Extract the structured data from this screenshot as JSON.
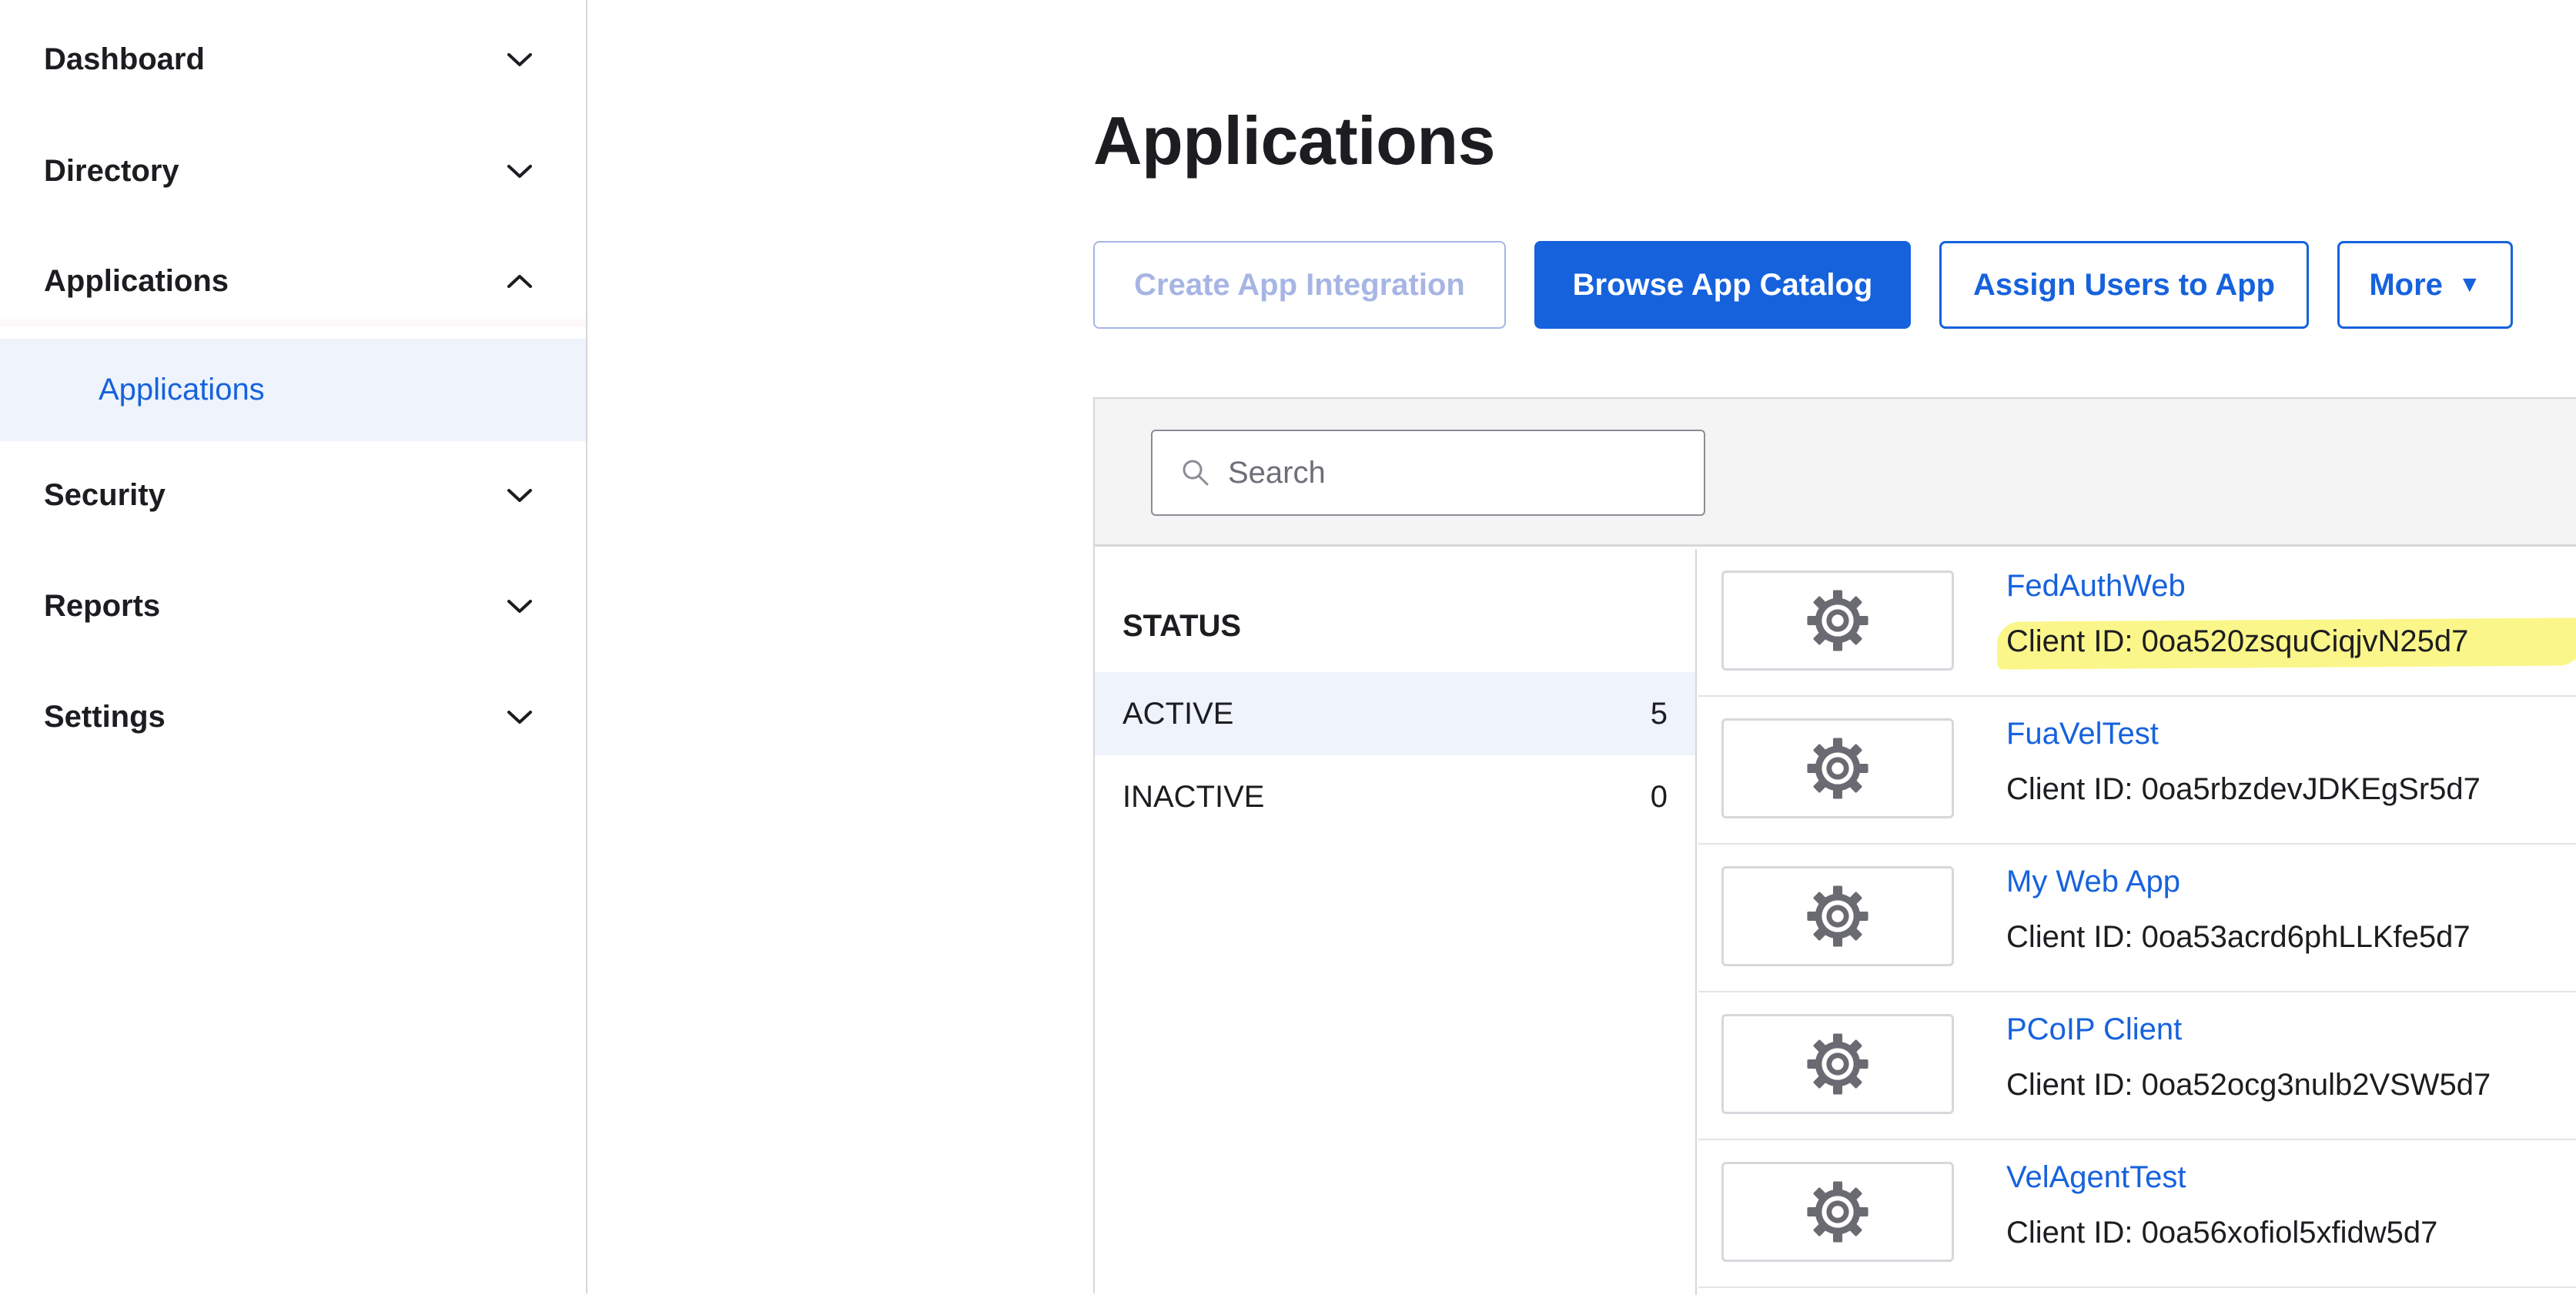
{
  "sidebar": {
    "items": [
      {
        "label": "Dashboard",
        "expanded": false
      },
      {
        "label": "Directory",
        "expanded": false
      },
      {
        "label": "Applications",
        "expanded": true
      },
      {
        "label": "Security",
        "expanded": false
      },
      {
        "label": "Reports",
        "expanded": false
      },
      {
        "label": "Settings",
        "expanded": false
      }
    ],
    "sub_item": {
      "label": "Applications",
      "selected": true
    }
  },
  "main": {
    "title": "Applications",
    "buttons": {
      "create": "Create App Integration",
      "browse": "Browse App Catalog",
      "assign": "Assign Users to App",
      "more": "More",
      "more_caret": "▼"
    },
    "search": {
      "placeholder": "Search",
      "value": ""
    },
    "status": {
      "heading": "STATUS",
      "rows": [
        {
          "label": "ACTIVE",
          "count": "5",
          "selected": true
        },
        {
          "label": "INACTIVE",
          "count": "0",
          "selected": false
        }
      ]
    },
    "apps": [
      {
        "name": "FedAuthWeb",
        "client_id": "Client ID: 0oa520zsquCiqjvN25d7",
        "highlighted": true,
        "icon": "gear-icon"
      },
      {
        "name": "FuaVelTest",
        "client_id": "Client ID: 0oa5rbzdevJDKEgSr5d7",
        "highlighted": false,
        "icon": "gear-icon"
      },
      {
        "name": "My Web App",
        "client_id": "Client ID: 0oa53acrd6phLLKfe5d7",
        "highlighted": false,
        "icon": "gear-icon"
      },
      {
        "name": "PCoIP Client",
        "client_id": "Client ID: 0oa52ocg3nulb2VSW5d7",
        "highlighted": false,
        "icon": "gear-icon"
      },
      {
        "name": "VelAgentTest",
        "client_id": "Client ID: 0oa56xofiol5xfidw5d7",
        "highlighted": false,
        "icon": "gear-icon"
      }
    ]
  },
  "colors": {
    "accent": "#1662dd",
    "selected_bg": "#eef3fc",
    "highlight": "#fbf68a",
    "disabled": "#a7b5e4"
  }
}
